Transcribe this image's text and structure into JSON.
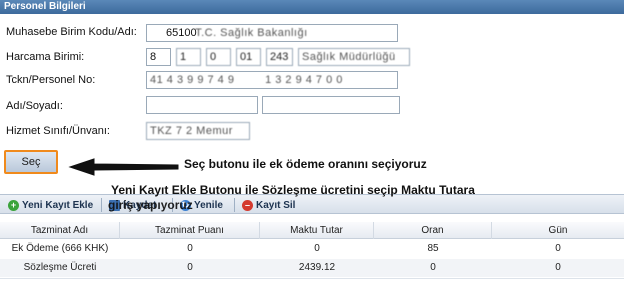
{
  "panel": {
    "title": "Personel Bilgileri"
  },
  "form": {
    "rows": [
      {
        "label": "Muhasebe Birim Kodu/Adı:",
        "value_main": "65100",
        "value_blur": "T.C. Sağlık Bakanlığı"
      },
      {
        "label": "Harcama Birimi:",
        "seg1": "8",
        "seg2": "1",
        "seg3": "0",
        "seg4": "01",
        "seg5": "243",
        "value_blur": "Sağlık Müdürlüğü"
      },
      {
        "label": "Tckn/Personel No:",
        "value_blur": "41 4 3 9 9 7 4 9",
        "value_blur2": "1 3 2 9 4 7 0 0"
      },
      {
        "label": "Adı/Soyadı:",
        "value_blur": "",
        "value_blur2": ""
      },
      {
        "label": "Hizmet Sınıfı/Ünvanı:",
        "value_blur": "TKZ 7 2 Memur"
      }
    ],
    "select_button": "Seç"
  },
  "annotations": {
    "a1": "Seç butonu ile ek ödeme oranını seçiyoruz",
    "a2_line1": "Yeni Kayıt Ekle Butonu ile Sözleşme ücretini seçip Maktu Tutara",
    "a2_line2": "giriş yapıyoruz"
  },
  "toolbar": {
    "new": "Yeni Kayıt Ekle",
    "save": "Kaydet",
    "refresh": "Yenile",
    "delete": "Kayıt Sil"
  },
  "grid": {
    "headers": [
      "Tazminat Adı",
      "Tazminat Puanı",
      "Maktu Tutar",
      "Oran",
      "Gün"
    ],
    "rows": [
      [
        "Ek Ödeme (666 KHK)",
        "0",
        "0",
        "85",
        "0"
      ],
      [
        "Sözleşme Ücreti",
        "0",
        "2439.12",
        "0",
        "0"
      ]
    ]
  },
  "colors": {
    "header_blue": "#3d6a9c",
    "accent_orange": "#f08a1c",
    "add_green": "#3ba33b",
    "delete_red": "#d43a2f"
  }
}
